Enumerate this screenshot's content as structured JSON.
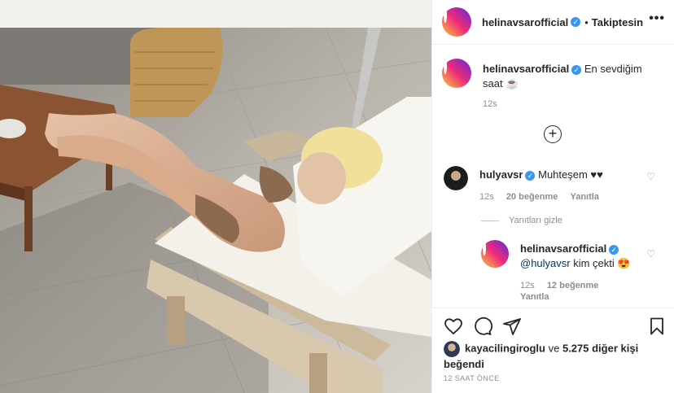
{
  "post": {
    "username": "helinavsarofficial",
    "follow_status": "Takiptesin",
    "dot": "•",
    "more_icon": "•••"
  },
  "caption": {
    "username": "helinavsarofficial",
    "text": "En sevdiğim saat ☕",
    "time": "12s"
  },
  "comments": [
    {
      "username": "hulyavsr",
      "text": "Muhteşem ♥♥",
      "time": "12s",
      "likes": "20 beğenme",
      "reply_label": "Yanıtla"
    }
  ],
  "hide_replies": "Yanıtları gizle",
  "reply": {
    "username": "helinavsarofficial",
    "mention": "@hulyavsr",
    "text": " kim çekti 😍",
    "time": "12s",
    "likes": "12 beğenme",
    "reply_label": "Yanıtla"
  },
  "likes_line": {
    "user": "kayacilingiroglu",
    "connector": "ve",
    "others": "5.275 diğer kişi",
    "verb": "beğendi"
  },
  "posted_ago": "12 SAAT ÖNCE",
  "icons": {
    "verified": "verified-badge-icon",
    "heart": "heart-icon",
    "comment": "comment-icon",
    "share": "paper-plane-icon",
    "save": "bookmark-icon",
    "load_more": "plus-circle-icon"
  },
  "colors": {
    "verified": "#3897f0",
    "secondary_text": "#8e8e8e",
    "border": "#efefef"
  }
}
